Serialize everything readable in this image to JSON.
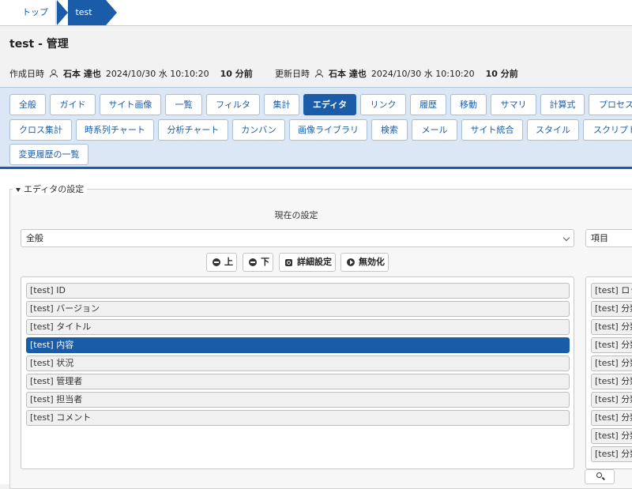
{
  "breadcrumb": {
    "home": "トップ",
    "current": "test"
  },
  "header": {
    "title": "test - 管理",
    "created": {
      "label": "作成日時",
      "user": "石本 達也",
      "datetime": "2024/10/30 水 10:10:20",
      "ago": "10 分前"
    },
    "updated": {
      "label": "更新日時",
      "user": "石本 達也",
      "datetime": "2024/10/30 水 10:10:20",
      "ago": "10 分前"
    }
  },
  "tabs": {
    "row1": [
      "全般",
      "ガイド",
      "サイト画像",
      "一覧",
      "フィルタ",
      "集計",
      "エディタ",
      "リンク",
      "履歴",
      "移動",
      "サマリ",
      "計算式",
      "プロセス"
    ],
    "row2": [
      "クロス集計",
      "時系列チャート",
      "分析チャート",
      "カンバン",
      "画像ライブラリ",
      "検索",
      "メール",
      "サイト統合",
      "スタイル",
      "スクリプト"
    ],
    "row3": [
      "変更履歴の一覧"
    ],
    "active": "エディタ"
  },
  "editor": {
    "legend": "エディタの設定",
    "current_setting": "現在の設定",
    "section_select": "全般",
    "right_select": "項目",
    "buttons": {
      "up": "上",
      "down": "下",
      "advanced": "詳細設定",
      "disable": "無効化"
    },
    "columns": [
      "[test] ID",
      "[test] バージョン",
      "[test] タイトル",
      "[test] 内容",
      "[test] 状況",
      "[test] 管理者",
      "[test] 担当者",
      "[test] コメント"
    ],
    "selected_column": "[test] 内容",
    "source_columns": [
      "[test] ロック",
      "[test] 分類",
      "[test] 分類",
      "[test] 分類",
      "[test] 分類",
      "[test] 分類",
      "[test] 分類",
      "[test] 分類",
      "[test] 分類",
      "[test] 分類"
    ]
  }
}
